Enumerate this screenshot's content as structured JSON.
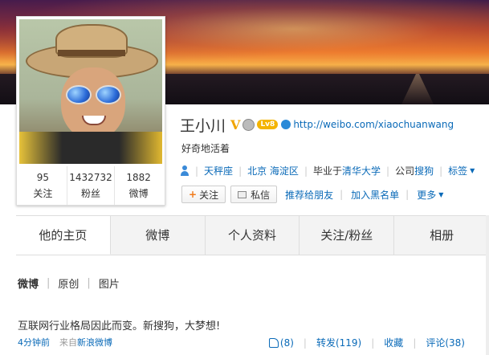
{
  "profile": {
    "name": "王小川",
    "verified_badge": "V",
    "level_badge": "Lv8",
    "url": "http://weibo.com/xiaochuanwang",
    "tagline": "好奇地活着",
    "info": {
      "zodiac": "天秤座",
      "location": "北京 海淀区",
      "school_prefix": "毕业于",
      "school": "清华大学",
      "company_prefix": "公司",
      "company": "搜狗",
      "tags": "标签"
    }
  },
  "stats": [
    {
      "value": "95",
      "label": "关注"
    },
    {
      "value": "1432732",
      "label": "粉丝"
    },
    {
      "value": "1882",
      "label": "微博"
    }
  ],
  "actions": {
    "follow": "关注",
    "message": "私信",
    "recommend": "推荐给朋友",
    "blacklist": "加入黑名单",
    "more": "更多"
  },
  "tabs": [
    "他的主页",
    "微博",
    "个人资料",
    "关注/粉丝",
    "相册"
  ],
  "subnav": [
    "微博",
    "原创",
    "图片"
  ],
  "post": {
    "text": "互联网行业格局因此而变。新搜狗，大梦想!",
    "time": "4分钟前",
    "source_prefix": "来自",
    "source": "新浪微博",
    "likes": "(8)",
    "repost": "转发(119)",
    "favorite": "收藏",
    "comment": "评论(38)"
  },
  "icons": {
    "verified": "verified-v-icon",
    "medal": "medal-icon",
    "level": "level-badge-icon",
    "link": "link-icon",
    "person": "person-icon",
    "caret": "caret-down-icon",
    "plus": "plus-icon",
    "mail": "mail-icon",
    "like": "thumb-up-icon"
  },
  "colors": {
    "link": "#0a6ab8",
    "verified": "#f0a400",
    "follow_plus": "#f07a1a"
  }
}
